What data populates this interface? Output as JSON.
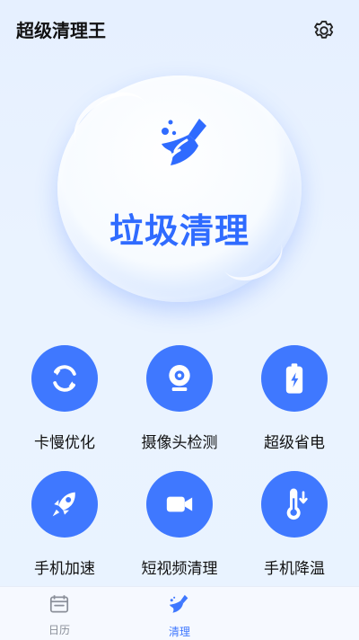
{
  "header": {
    "app_title": "超级清理王",
    "settings_icon": "gear-icon"
  },
  "hero": {
    "label": "垃圾清理",
    "icon": "broom-icon",
    "accent": "#2f6bff"
  },
  "features": [
    {
      "label": "卡慢优化",
      "icon": "refresh-icon"
    },
    {
      "label": "摄像头检测",
      "icon": "camera-icon"
    },
    {
      "label": "超级省电",
      "icon": "battery-icon"
    },
    {
      "label": "手机加速",
      "icon": "rocket-icon"
    },
    {
      "label": "短视频清理",
      "icon": "video-icon"
    },
    {
      "label": "手机降温",
      "icon": "thermometer-icon"
    }
  ],
  "nav": {
    "items": [
      {
        "label": "日历",
        "icon": "calendar-icon",
        "active": false
      },
      {
        "label": "清理",
        "icon": "broom-icon",
        "active": true
      }
    ]
  },
  "colors": {
    "primary": "#3f78ff",
    "background": "#e6f0ff"
  }
}
